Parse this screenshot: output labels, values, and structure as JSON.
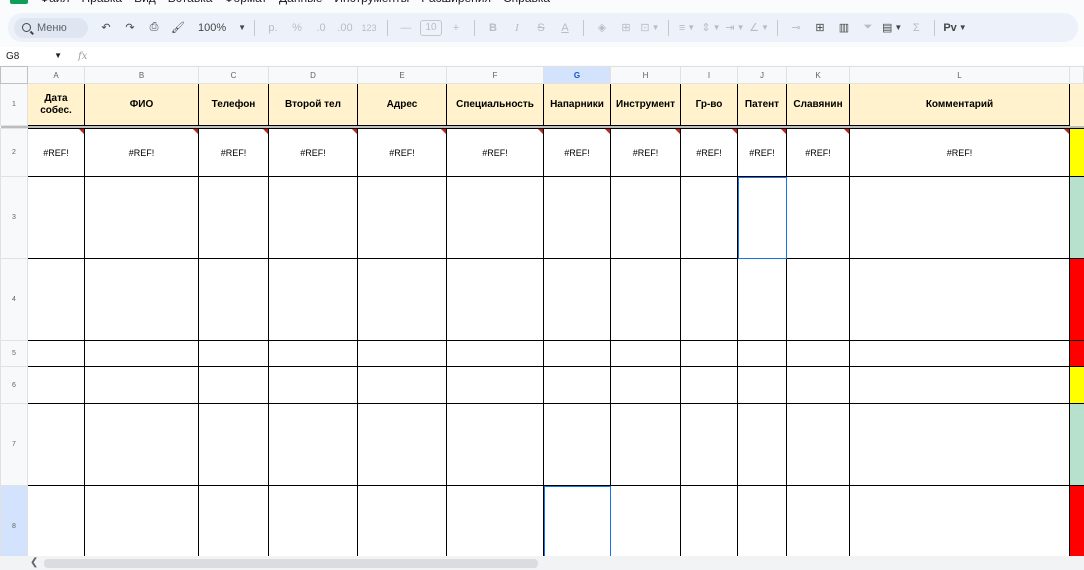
{
  "menu": {
    "items": [
      "Файл",
      "Правка",
      "Вид",
      "Вставка",
      "Формат",
      "Данные",
      "Инструменты",
      "Расширения",
      "Справка"
    ]
  },
  "toolbar": {
    "search_label": "Меню",
    "zoom": "100%",
    "currency_label": "р.",
    "percent_label": "%",
    "decrease_decimal_label": ".0",
    "increase_decimal_label": ".00",
    "number_format_label": "123",
    "font_size": "10",
    "bold_label": "B",
    "italic_label": "I",
    "strikethrough_label": "S",
    "text_color_label": "A",
    "sum_label": "Σ",
    "input_tools_label": "Pv"
  },
  "formula_bar": {
    "name_box": "G8",
    "fx_label": "fx",
    "value": ""
  },
  "columns": [
    "A",
    "B",
    "C",
    "D",
    "E",
    "F",
    "G",
    "H",
    "I",
    "J",
    "K",
    "L"
  ],
  "selected_column": "G",
  "header_row": {
    "row_number": "1",
    "cells": [
      "Дата собес.",
      "ФИО",
      "Телефон",
      "Второй тел",
      "Адрес",
      "Специальность",
      "Напарники",
      "Инструмент",
      "Гр-во",
      "Патент",
      "Славянин",
      "Комментарий"
    ]
  },
  "data_rows": [
    {
      "row_number": "2",
      "cells": [
        "#REF!",
        "#REF!",
        "#REF!",
        "#REF!",
        "#REF!",
        "#REF!",
        "#REF!",
        "#REF!",
        "#REF!",
        "#REF!",
        "#REF!",
        "#REF!"
      ],
      "status_color": "#ffff00"
    },
    {
      "row_number": "3",
      "cells": [
        "",
        "",
        "",
        "",
        "",
        "",
        "",
        "",
        "",
        "",
        "",
        ""
      ],
      "status_color": "#b7e1cd"
    },
    {
      "row_number": "4",
      "cells": [
        "",
        "",
        "",
        "",
        "",
        "",
        "",
        "",
        "",
        "",
        "",
        ""
      ],
      "status_color": "#ff0000"
    },
    {
      "row_number": "5",
      "cells": [
        "",
        "",
        "",
        "",
        "",
        "",
        "",
        "",
        "",
        "",
        "",
        ""
      ],
      "status_color": "#ff0000"
    },
    {
      "row_number": "6",
      "cells": [
        "",
        "",
        "",
        "",
        "",
        "",
        "",
        "",
        "",
        "",
        "",
        ""
      ],
      "status_color": "#ffff00"
    },
    {
      "row_number": "7",
      "cells": [
        "",
        "",
        "",
        "",
        "",
        "",
        "",
        "",
        "",
        "",
        "",
        ""
      ],
      "status_color": "#b7e1cd"
    },
    {
      "row_number": "8",
      "cells": [
        "",
        "",
        "",
        "",
        "",
        "",
        "",
        "",
        "",
        "",
        "",
        ""
      ],
      "status_color": "#ff0000"
    }
  ],
  "colors": {
    "header_fill": "#fff2cc",
    "selection": "#1a73e8",
    "error_flag": "#c5221f"
  }
}
